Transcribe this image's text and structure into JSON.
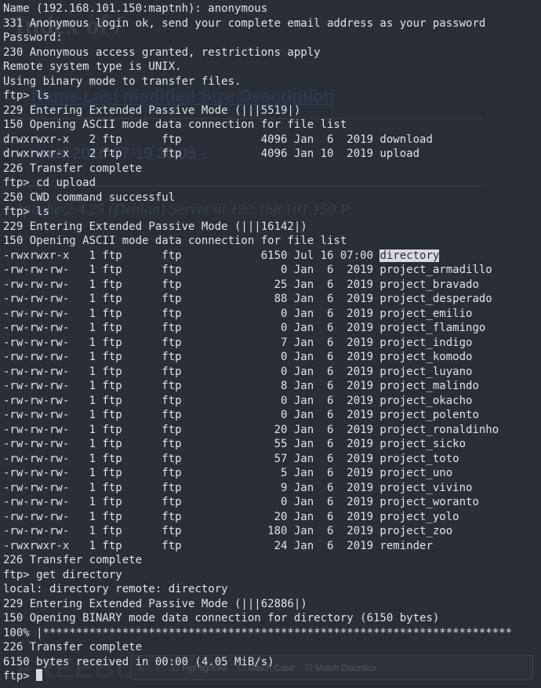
{
  "bg": {
    "title": "Index of /",
    "headers": "Name   Last modified   Size Description",
    "row1": "sec/  2016-07-19 20:05   -",
    "footer": "Apache/2.4.25 (Debian) Server at 192.168.101.150 P",
    "watermark": "FREEBUF",
    "search_highlight": "Highlight All",
    "search_matchcase": "Match Case",
    "search_diacritics": "Match Diacritics"
  },
  "session": {
    "name_prompt": "Name (192.168.101.150:maptnh): ",
    "name_input": "anonymous",
    "msg_331": "331 Anonymous login ok, send your complete email address as your password",
    "pass_prompt": "Password:",
    "msg_230": "230 Anonymous access granted, restrictions apply",
    "msg_systype": "Remote system type is UNIX.",
    "msg_binmode": "Using binary mode to transfer files.",
    "prompt": "ftp> ",
    "cmd_ls1": "ls",
    "msg_229a": "229 Entering Extended Passive Mode (|||5519|)",
    "msg_150a": "150 Opening ASCII mode data connection for file list",
    "msg_226a": "226 Transfer complete",
    "cmd_cd": "cd upload",
    "msg_250": "250 CWD command successful",
    "cmd_ls2": "ls",
    "msg_229b": "229 Entering Extended Passive Mode (|||16142|)",
    "msg_150b": "150 Opening ASCII mode data connection for file list",
    "msg_226b": "226 Transfer complete",
    "cmd_get": "get directory",
    "msg_local": "local: directory remote: directory",
    "msg_229c": "229 Entering Extended Passive Mode (|||62886|)",
    "msg_150c": "150 Opening BINARY mode data connection for directory (6150 bytes)",
    "msg_progress": "100% |***********************************************************************",
    "msg_226c": "226 Transfer complete",
    "msg_recv": "6150 bytes received in 00:00 (4.05 MiB/s)"
  },
  "dir1": [
    {
      "perms": "drwxrwxr-x",
      "links": "2",
      "owner": "ftp",
      "group": "ftp",
      "size": "4096",
      "date": "Jan  6  2019",
      "name": "download"
    },
    {
      "perms": "drwxrwxr-x",
      "links": "2",
      "owner": "ftp",
      "group": "ftp",
      "size": "4096",
      "date": "Jan 10  2019",
      "name": "upload"
    }
  ],
  "dir2": [
    {
      "perms": "-rwxrwxr-x",
      "links": "1",
      "owner": "ftp",
      "group": "ftp",
      "size": "6150",
      "date": "Jul 16 07:00",
      "name": "directory",
      "hl": true
    },
    {
      "perms": "-rw-rw-rw-",
      "links": "1",
      "owner": "ftp",
      "group": "ftp",
      "size": "0",
      "date": "Jan  6  2019",
      "name": "project_armadillo"
    },
    {
      "perms": "-rw-rw-rw-",
      "links": "1",
      "owner": "ftp",
      "group": "ftp",
      "size": "25",
      "date": "Jan  6  2019",
      "name": "project_bravado"
    },
    {
      "perms": "-rw-rw-rw-",
      "links": "1",
      "owner": "ftp",
      "group": "ftp",
      "size": "88",
      "date": "Jan  6  2019",
      "name": "project_desperado"
    },
    {
      "perms": "-rw-rw-rw-",
      "links": "1",
      "owner": "ftp",
      "group": "ftp",
      "size": "0",
      "date": "Jan  6  2019",
      "name": "project_emilio"
    },
    {
      "perms": "-rw-rw-rw-",
      "links": "1",
      "owner": "ftp",
      "group": "ftp",
      "size": "0",
      "date": "Jan  6  2019",
      "name": "project_flamingo"
    },
    {
      "perms": "-rw-rw-rw-",
      "links": "1",
      "owner": "ftp",
      "group": "ftp",
      "size": "7",
      "date": "Jan  6  2019",
      "name": "project_indigo"
    },
    {
      "perms": "-rw-rw-rw-",
      "links": "1",
      "owner": "ftp",
      "group": "ftp",
      "size": "0",
      "date": "Jan  6  2019",
      "name": "project_komodo"
    },
    {
      "perms": "-rw-rw-rw-",
      "links": "1",
      "owner": "ftp",
      "group": "ftp",
      "size": "0",
      "date": "Jan  6  2019",
      "name": "project_luyano"
    },
    {
      "perms": "-rw-rw-rw-",
      "links": "1",
      "owner": "ftp",
      "group": "ftp",
      "size": "8",
      "date": "Jan  6  2019",
      "name": "project_malindo"
    },
    {
      "perms": "-rw-rw-rw-",
      "links": "1",
      "owner": "ftp",
      "group": "ftp",
      "size": "0",
      "date": "Jan  6  2019",
      "name": "project_okacho"
    },
    {
      "perms": "-rw-rw-rw-",
      "links": "1",
      "owner": "ftp",
      "group": "ftp",
      "size": "0",
      "date": "Jan  6  2019",
      "name": "project_polento"
    },
    {
      "perms": "-rw-rw-rw-",
      "links": "1",
      "owner": "ftp",
      "group": "ftp",
      "size": "20",
      "date": "Jan  6  2019",
      "name": "project_ronaldinho"
    },
    {
      "perms": "-rw-rw-rw-",
      "links": "1",
      "owner": "ftp",
      "group": "ftp",
      "size": "55",
      "date": "Jan  6  2019",
      "name": "project_sicko"
    },
    {
      "perms": "-rw-rw-rw-",
      "links": "1",
      "owner": "ftp",
      "group": "ftp",
      "size": "57",
      "date": "Jan  6  2019",
      "name": "project_toto"
    },
    {
      "perms": "-rw-rw-rw-",
      "links": "1",
      "owner": "ftp",
      "group": "ftp",
      "size": "5",
      "date": "Jan  6  2019",
      "name": "project_uno"
    },
    {
      "perms": "-rw-rw-rw-",
      "links": "1",
      "owner": "ftp",
      "group": "ftp",
      "size": "9",
      "date": "Jan  6  2019",
      "name": "project_vivino"
    },
    {
      "perms": "-rw-rw-rw-",
      "links": "1",
      "owner": "ftp",
      "group": "ftp",
      "size": "0",
      "date": "Jan  6  2019",
      "name": "project_woranto"
    },
    {
      "perms": "-rw-rw-rw-",
      "links": "1",
      "owner": "ftp",
      "group": "ftp",
      "size": "20",
      "date": "Jan  6  2019",
      "name": "project_yolo"
    },
    {
      "perms": "-rw-rw-rw-",
      "links": "1",
      "owner": "ftp",
      "group": "ftp",
      "size": "180",
      "date": "Jan  6  2019",
      "name": "project_zoo"
    },
    {
      "perms": "-rwxrwxr-x",
      "links": "1",
      "owner": "ftp",
      "group": "ftp",
      "size": "24",
      "date": "Jan  6  2019",
      "name": "reminder"
    }
  ]
}
